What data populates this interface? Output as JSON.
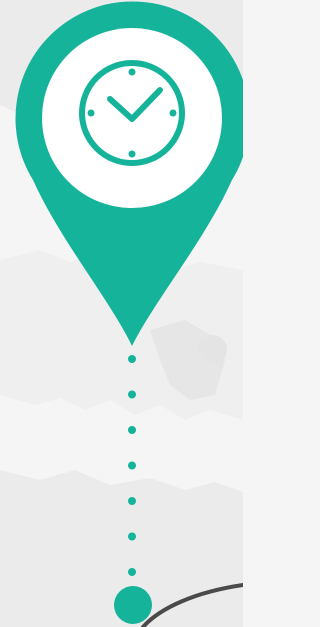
{
  "colors": {
    "background": "#f5f5f5",
    "map_land": "#ebebeb",
    "map_land_light": "#efefef",
    "pin_accent": "#16b39b",
    "pin_inner": "#ffffff",
    "route_line": "#4a4a4a"
  },
  "icons": {
    "pin": "location-pin-icon",
    "clock": "clock-icon"
  },
  "dotted_connector": {
    "dot_count": 7
  }
}
